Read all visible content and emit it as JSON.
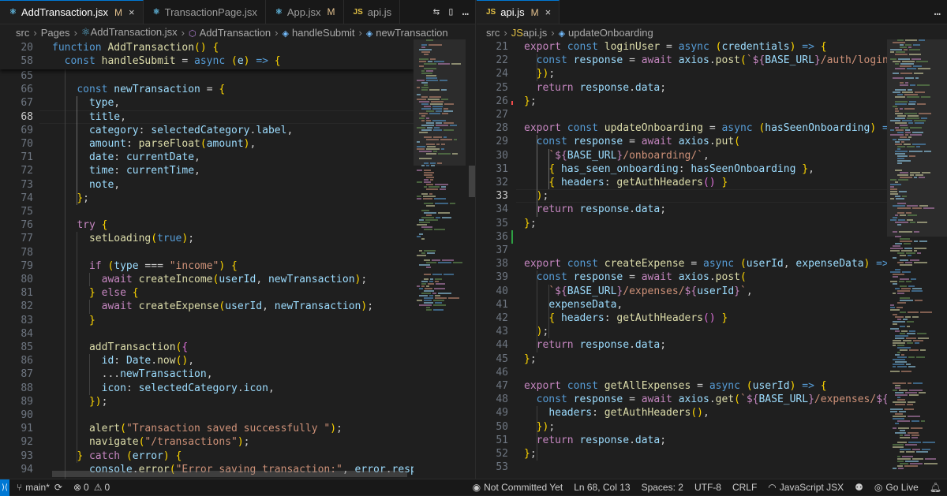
{
  "left_tabs": [
    {
      "label": "AddTransaction.jsx",
      "icon": "react-icon",
      "badge": "M",
      "active": true
    },
    {
      "label": "TransactionPage.jsx",
      "icon": "react-icon",
      "badge": "",
      "active": false
    },
    {
      "label": "App.jsx",
      "icon": "react-icon",
      "badge": "M",
      "active": false
    },
    {
      "label": "api.js",
      "icon": "js-icon",
      "badge": "",
      "active": false
    }
  ],
  "right_tabs": [
    {
      "label": "api.js",
      "icon": "js-icon",
      "badge": "M",
      "active": true
    }
  ],
  "icon_glyphs": {
    "react": "⚛",
    "js": "JS",
    "close": "×",
    "split": "▯",
    "compare": "⇆",
    "more": "…",
    "symbol": "⬡",
    "method": "◈"
  },
  "left_breadcrumb": [
    "src",
    "Pages",
    "AddTransaction.jsx",
    "AddTransaction",
    "handleSubmit",
    "newTransaction"
  ],
  "right_breadcrumb": [
    "src",
    "api.js",
    "updateOnboarding"
  ],
  "left_editor": {
    "sticky": [
      {
        "n": "20",
        "t": "function AddTransaction() {"
      },
      {
        "n": "58",
        "t": "  const handleSubmit = async (e) => {"
      }
    ],
    "lines": [
      {
        "n": "65",
        "t": ""
      },
      {
        "n": "66",
        "t": "    const newTransaction = {"
      },
      {
        "n": "67",
        "t": "      type,"
      },
      {
        "n": "68",
        "t": "      title,"
      },
      {
        "n": "69",
        "t": "      category: selectedCategory.label,"
      },
      {
        "n": "70",
        "t": "      amount: parseFloat(amount),"
      },
      {
        "n": "71",
        "t": "      date: currentDate,"
      },
      {
        "n": "72",
        "t": "      time: currentTime,"
      },
      {
        "n": "73",
        "t": "      note,"
      },
      {
        "n": "74",
        "t": "    };"
      },
      {
        "n": "75",
        "t": ""
      },
      {
        "n": "76",
        "t": "    try {"
      },
      {
        "n": "77",
        "t": "      setLoading(true);"
      },
      {
        "n": "78",
        "t": ""
      },
      {
        "n": "79",
        "t": "      if (type === \"income\") {"
      },
      {
        "n": "80",
        "t": "        await createIncome(userId, newTransaction);"
      },
      {
        "n": "81",
        "t": "      } else {"
      },
      {
        "n": "82",
        "t": "        await createExpense(userId, newTransaction);"
      },
      {
        "n": "83",
        "t": "      }"
      },
      {
        "n": "84",
        "t": ""
      },
      {
        "n": "85",
        "t": "      addTransaction({"
      },
      {
        "n": "86",
        "t": "        id: Date.now(),"
      },
      {
        "n": "87",
        "t": "        ...newTransaction,"
      },
      {
        "n": "88",
        "t": "        icon: selectedCategory.icon,"
      },
      {
        "n": "89",
        "t": "      });"
      },
      {
        "n": "90",
        "t": ""
      },
      {
        "n": "91",
        "t": "      alert(\"Transaction saved successfully \");"
      },
      {
        "n": "92",
        "t": "      navigate(\"/transactions\");"
      },
      {
        "n": "93",
        "t": "    } catch (error) {"
      },
      {
        "n": "94",
        "t": "      console.error(\"Error saving transaction:\", error.response?.d"
      }
    ]
  },
  "right_editor": {
    "lines": [
      {
        "n": "21",
        "t": "export const loginUser = async (credentials) => {"
      },
      {
        "n": "22",
        "t": "  const response = await axios.post(`${BASE_URL}/auth/login`, cred"
      },
      {
        "n": "24",
        "t": "  });"
      },
      {
        "n": "25",
        "t": "  return response.data;"
      },
      {
        "n": "26",
        "t": "};"
      },
      {
        "n": "27",
        "t": ""
      },
      {
        "n": "28",
        "t": "export const updateOnboarding = async (hasSeenOnboarding) => {"
      },
      {
        "n": "29",
        "t": "  const response = await axios.put("
      },
      {
        "n": "30",
        "t": "    `${BASE_URL}/onboarding/`,"
      },
      {
        "n": "31",
        "t": "    { has_seen_onboarding: hasSeenOnboarding },"
      },
      {
        "n": "32",
        "t": "    { headers: getAuthHeaders() }"
      },
      {
        "n": "33",
        "t": "  );"
      },
      {
        "n": "34",
        "t": "  return response.data;"
      },
      {
        "n": "35",
        "t": "};"
      },
      {
        "n": "36",
        "t": ""
      },
      {
        "n": "37",
        "t": ""
      },
      {
        "n": "38",
        "t": "export const createExpense = async (userId, expenseData) => {"
      },
      {
        "n": "39",
        "t": "  const response = await axios.post("
      },
      {
        "n": "40",
        "t": "    `${BASE_URL}/expenses/${userId}`,"
      },
      {
        "n": "41",
        "t": "    expenseData,"
      },
      {
        "n": "42",
        "t": "    { headers: getAuthHeaders() }"
      },
      {
        "n": "43",
        "t": "  );"
      },
      {
        "n": "44",
        "t": "  return response.data;"
      },
      {
        "n": "45",
        "t": "};"
      },
      {
        "n": "46",
        "t": ""
      },
      {
        "n": "47",
        "t": "export const getAllExpenses = async (userId) => {"
      },
      {
        "n": "48",
        "t": "  const response = await axios.get(`${BASE_URL}/expenses/${userId"
      },
      {
        "n": "49",
        "t": "    headers: getAuthHeaders(),"
      },
      {
        "n": "50",
        "t": "  });"
      },
      {
        "n": "51",
        "t": "  return response.data;"
      },
      {
        "n": "52",
        "t": "};"
      },
      {
        "n": "53",
        "t": ""
      }
    ]
  },
  "current_line": {
    "left": "68",
    "right": "33"
  },
  "status": {
    "branch": "main*",
    "sync_icon": "sync-icon",
    "problems": "0",
    "warnings": "0",
    "not_committed": "Not Committed Yet",
    "position": "Ln 68, Col 13",
    "spaces": "Spaces: 2",
    "encoding": "UTF-8",
    "eol": "CRLF",
    "language": "JavaScript JSX",
    "golive": "Go Live"
  },
  "colors": {
    "accent": "#0078d4",
    "background": "#1f1f1f",
    "modified": "#e2c08d"
  }
}
